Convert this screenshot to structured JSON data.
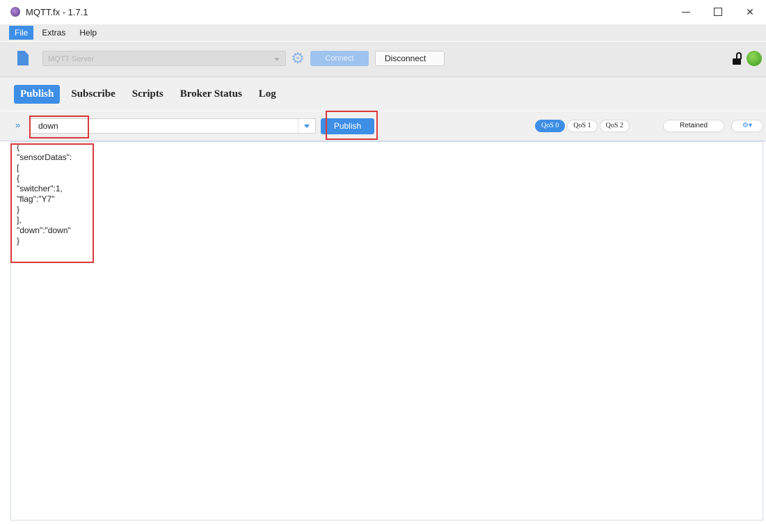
{
  "window": {
    "title": "MQTT.fx - 1.7.1",
    "app_icon": "mqttfx-logo-icon",
    "controls": [
      "minimize",
      "maximize",
      "close"
    ],
    "close_glyph": "✕"
  },
  "menu": {
    "items": [
      {
        "label": "File",
        "active": true
      },
      {
        "label": "Extras",
        "active": false
      },
      {
        "label": "Help",
        "active": false
      }
    ]
  },
  "connection": {
    "profile_placeholder": "MQTT Server",
    "settings_icon": "gear-icon",
    "connect_label": "Connect",
    "disconnect_label": "Disconnect",
    "lock_icon": "unlock-icon",
    "status_color": "#4caf2a"
  },
  "tabs": [
    {
      "label": "Publish",
      "active": true
    },
    {
      "label": "Subscribe",
      "active": false
    },
    {
      "label": "Scripts",
      "active": false
    },
    {
      "label": "Broker Status",
      "active": false
    },
    {
      "label": "Log",
      "active": false
    }
  ],
  "publish": {
    "expand_glyph": "»",
    "topic": "down",
    "publish_label": "Publish",
    "qos": [
      {
        "label": "QoS 0",
        "selected": true
      },
      {
        "label": "QoS 1",
        "selected": false
      },
      {
        "label": "QoS 2",
        "selected": false
      }
    ],
    "retained_label": "Retained",
    "options_glyph": "⚙▾"
  },
  "payload": {
    "lines": [
      "{",
      "\"sensorDatas\":",
      "[",
      "{",
      "\"switcher\":1,",
      "\"flag\":\"Y7\"",
      "}",
      "],",
      "\"down\":\"down\"",
      "}"
    ]
  },
  "colors": {
    "accent": "#3d8ee6",
    "annotation": "#d8383a"
  }
}
